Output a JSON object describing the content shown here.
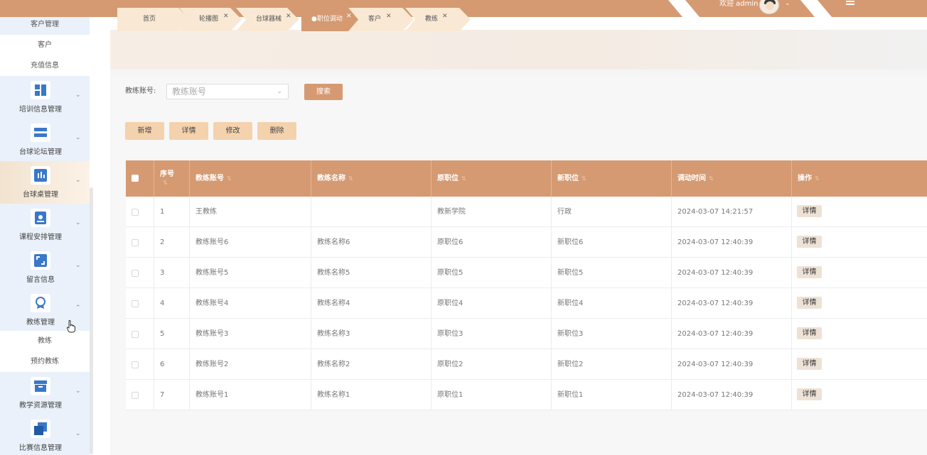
{
  "header": {
    "welcome": "欢迎 admin",
    "colors": {
      "bar": "#d59a72",
      "accent_light": "#f4d2ad"
    }
  },
  "sidebar": {
    "sub_top": [
      "客户管理",
      "客户",
      "充值信息"
    ],
    "groups": [
      {
        "label": "培训信息管理",
        "icon": "grid-icon"
      },
      {
        "label": "台球论坛管理",
        "icon": "list-icon"
      },
      {
        "label": "台球桌管理",
        "icon": "bars-icon"
      },
      {
        "label": "课程安排管理",
        "icon": "calendar-icon"
      },
      {
        "label": "留言信息",
        "icon": "frame-icon"
      },
      {
        "label": "教练管理",
        "icon": "badge-icon"
      },
      {
        "label": "教学资源管理",
        "icon": "box-icon"
      },
      {
        "label": "比赛信息管理",
        "icon": "copy-icon"
      }
    ],
    "coach_sub": [
      "教练",
      "预约教练"
    ]
  },
  "tabs": [
    {
      "label": "首页",
      "closable": false,
      "active": false
    },
    {
      "label": "轮播图",
      "closable": true,
      "active": false
    },
    {
      "label": "台球器械",
      "closable": true,
      "active": false
    },
    {
      "label": "●职位调动",
      "closable": true,
      "active": true
    },
    {
      "label": "客户",
      "closable": true,
      "active": false
    },
    {
      "label": "教练",
      "closable": true,
      "active": false
    }
  ],
  "search": {
    "label": "教练账号:",
    "placeholder": "教练账号",
    "button": "搜索"
  },
  "actions": {
    "add": "新增",
    "detail": "详情",
    "edit": "修改",
    "delete": "删除"
  },
  "table": {
    "headers": [
      "序号",
      "教练账号",
      "教练名称",
      "原职位",
      "新职位",
      "调动时间",
      "操作"
    ],
    "op_label": "详情",
    "rows": [
      [
        "1",
        "王教练",
        "",
        "教新学院",
        "行政",
        "2024-03-07 14:21:57"
      ],
      [
        "2",
        "教练账号6",
        "教练名称6",
        "原职位6",
        "新职位6",
        "2024-03-07 12:40:39"
      ],
      [
        "3",
        "教练账号5",
        "教练名称5",
        "原职位5",
        "新职位5",
        "2024-03-07 12:40:39"
      ],
      [
        "4",
        "教练账号4",
        "教练名称4",
        "原职位4",
        "新职位4",
        "2024-03-07 12:40:39"
      ],
      [
        "5",
        "教练账号3",
        "教练名称3",
        "原职位3",
        "新职位3",
        "2024-03-07 12:40:39"
      ],
      [
        "6",
        "教练账号2",
        "教练名称2",
        "原职位2",
        "新职位2",
        "2024-03-07 12:40:39"
      ],
      [
        "7",
        "教练账号1",
        "教练名称1",
        "原职位1",
        "新职位1",
        "2024-03-07 12:40:39"
      ]
    ]
  }
}
